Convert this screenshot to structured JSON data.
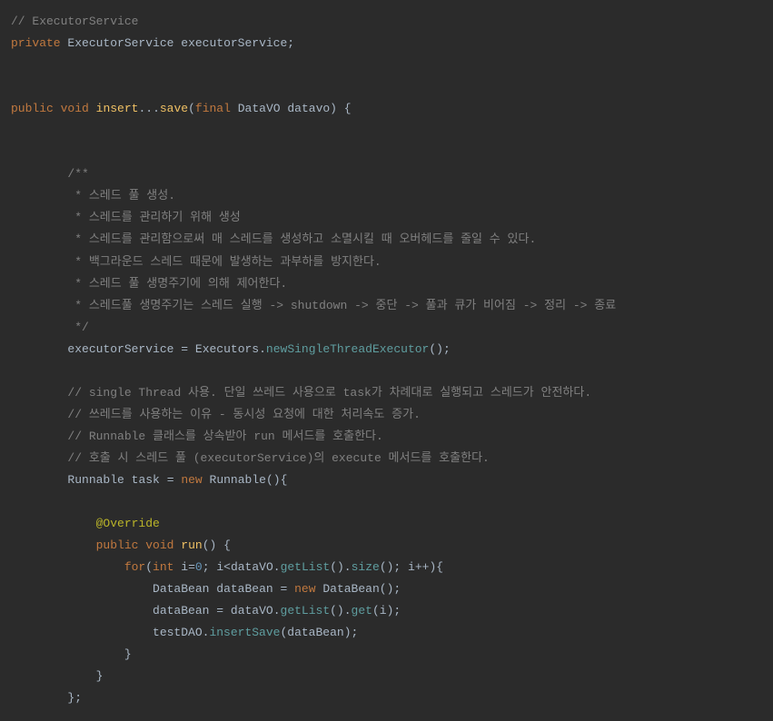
{
  "code": {
    "line1_comment": "// ExecutorService",
    "line2_private": "private",
    "line2_type": "ExecutorService",
    "line2_var": "executorService",
    "line4_public": "public",
    "line4_void": "void",
    "line4_method": "insert",
    "line4_save": "save",
    "line4_final": "final",
    "line4_paramtype": "DataVO",
    "line4_paramname": "datavo",
    "comment_block_start": "/**",
    "comment_line1": " * 스레드 풀 생성.",
    "comment_line2": " * 스레드를 관리하기 위해 생성",
    "comment_line3": " * 스레드를 관리함으로써 매 스레드를 생성하고 소멸시킬 때 오버헤드를 줄일 수 있다.",
    "comment_line4": " * 백그라운드 스레드 때문에 발생하는 과부하를 방지한다.",
    "comment_line5": " * 스레드 풀 생명주기에 의해 제어한다.",
    "comment_line6": " * 스레드풀 생명주기는 스레드 실행 -> shutdown -> 중단 -> 풀과 큐가 비어짐 -> 정리 -> 종료",
    "comment_block_end": " */",
    "exec_var": "executorService",
    "exec_class": "Executors",
    "exec_method": "newSingleThreadExecutor",
    "comment_single1": "// single Thread 사용. 단일 쓰레드 사용으로 task가 차례대로 실행되고 스레드가 안전하다.",
    "comment_single2": "// 쓰레드를 사용하는 이유 - 동시성 요청에 대한 처리속도 증가.",
    "comment_single3": "// Runnable 클래스를 상속받아 run 메서드를 호출한다.",
    "comment_single4": "// 호출 시 스레드 풀 (executorService)의 execute 메서드를 호출한다.",
    "runnable_type": "Runnable",
    "runnable_var": "task",
    "runnable_new": "new",
    "runnable_class": "Runnable",
    "override": "@Override",
    "run_public": "public",
    "run_void": "void",
    "run_method": "run",
    "for_keyword": "for",
    "for_int": "int",
    "for_var": "i",
    "for_zero": "0",
    "for_datavo": "dataVO",
    "for_getlist": "getList",
    "for_size": "size",
    "for_inc": "i++",
    "databean_type": "DataBean",
    "databean_var": "dataBean",
    "databean_new": "new",
    "databean_class": "DataBean",
    "assign_var": "dataBean",
    "assign_datavo": "dataVO",
    "assign_getlist": "getList",
    "assign_get": "get",
    "assign_i": "i",
    "testdao": "testDAO",
    "insertsave": "insertSave",
    "insertsave_param": "dataBean"
  }
}
